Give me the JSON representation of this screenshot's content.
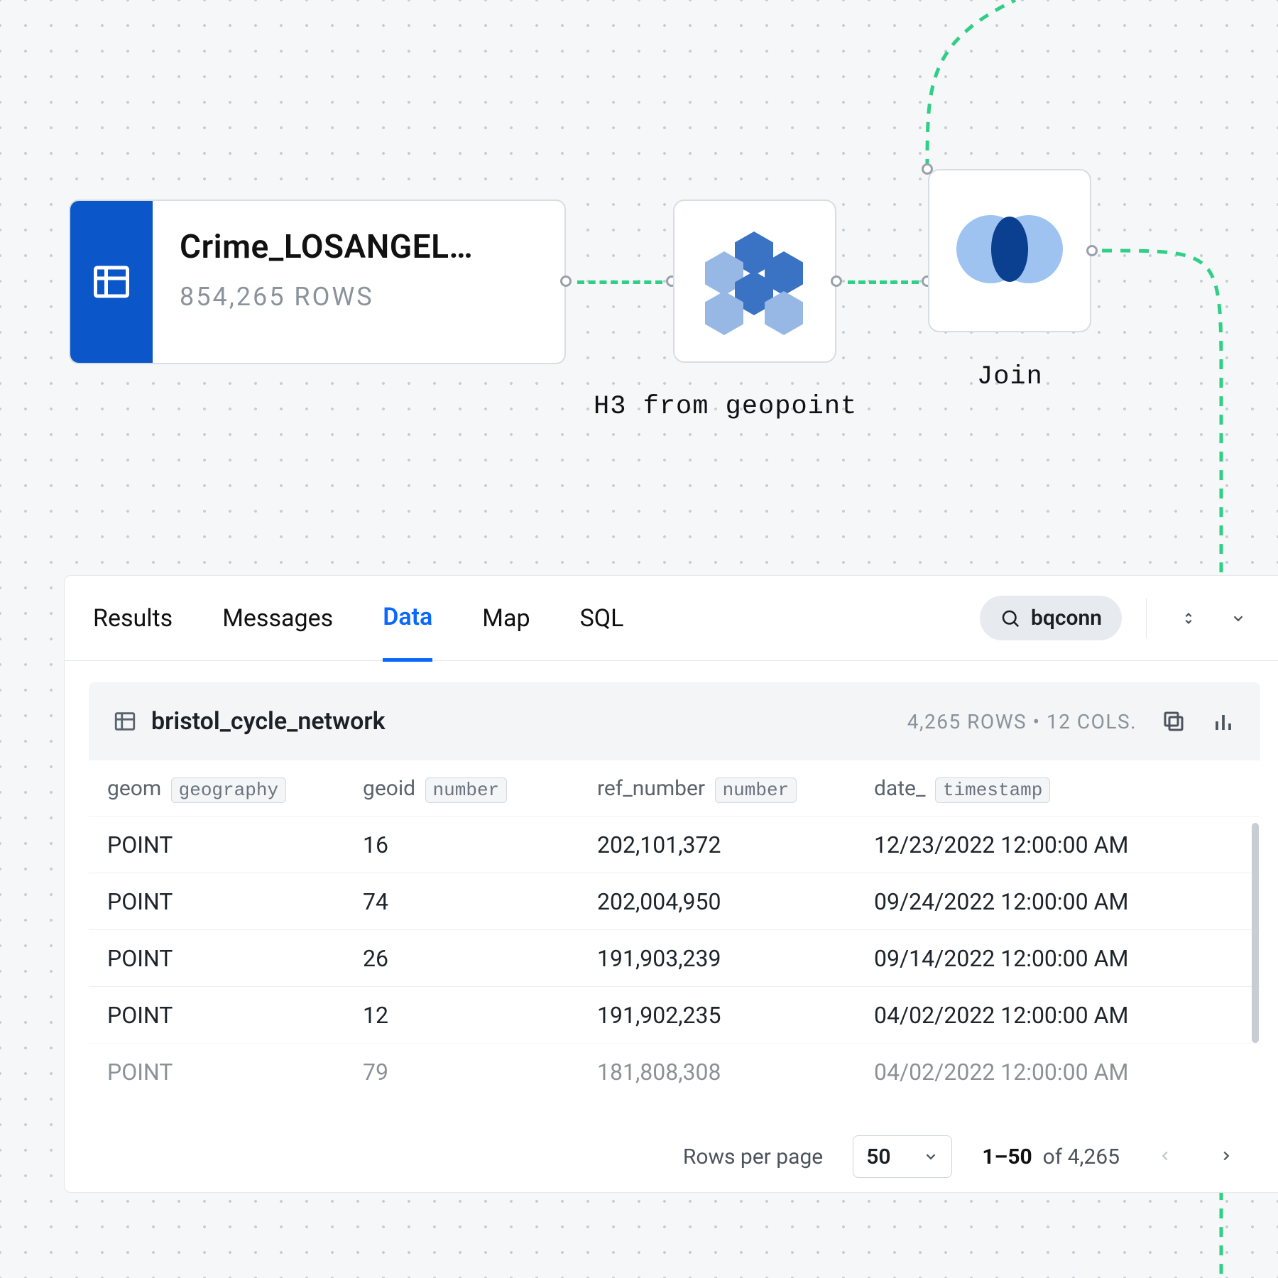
{
  "workflow": {
    "source": {
      "title": "Crime_LOSANGEL…",
      "rows_label": "854,265 ROWS"
    },
    "nodes": {
      "h3": {
        "label": "H3 from geopoint"
      },
      "join": {
        "label": "Join"
      }
    }
  },
  "panel": {
    "tabs": [
      "Results",
      "Messages",
      "Data",
      "Map",
      "SQL"
    ],
    "active_tab": "Data",
    "connection": "bqconn",
    "table": {
      "name": "bristol_cycle_network",
      "meta": "4,265 ROWS • 12 COLS.",
      "columns": [
        {
          "name": "geom",
          "type": "geography"
        },
        {
          "name": "geoid",
          "type": "number"
        },
        {
          "name": "ref_number",
          "type": "number"
        },
        {
          "name": "date_",
          "type": "timestamp"
        }
      ],
      "rows": [
        {
          "geom": "POINT",
          "geoid": "16",
          "ref_number": "202,101,372",
          "date_": "12/23/2022 12:00:00 AM"
        },
        {
          "geom": "POINT",
          "geoid": "74",
          "ref_number": "202,004,950",
          "date_": "09/24/2022 12:00:00 AM"
        },
        {
          "geom": "POINT",
          "geoid": "26",
          "ref_number": "191,903,239",
          "date_": "09/14/2022 12:00:00 AM"
        },
        {
          "geom": "POINT",
          "geoid": "12",
          "ref_number": "191,902,235",
          "date_": "04/02/2022 12:00:00 AM"
        },
        {
          "geom": "POINT",
          "geoid": "79",
          "ref_number": "181,808,308",
          "date_": "04/02/2022 12:00:00 AM",
          "partial": true
        }
      ]
    },
    "pager": {
      "rows_per_page_label": "Rows per page",
      "rows_per_page_value": "50",
      "range": "1–50",
      "total": "4,265",
      "of_label": "of"
    }
  }
}
